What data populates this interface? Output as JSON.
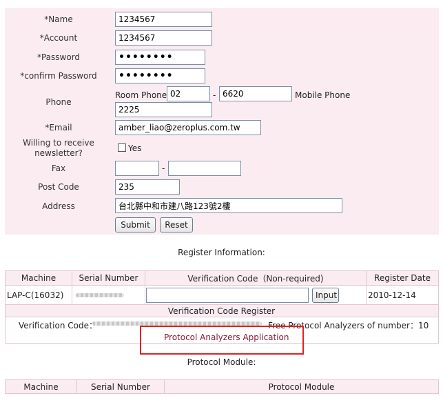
{
  "form": {
    "name_label": "*Name",
    "name_value": "1234567",
    "account_label": "*Account",
    "account_value": "1234567",
    "password_label": "*Password",
    "password_value": "••••••••",
    "confirm_label": "*confirm Password",
    "confirm_value": "••••••••",
    "phone_label": "Phone",
    "room_phone_label": "Room Phone",
    "room_phone_area": "02",
    "phone_dash": "-",
    "room_phone_number": "6620",
    "mobile_phone_label": "Mobile Phone",
    "ext_value": "2225",
    "email_label": "*Email",
    "email_value": "amber_liao@zeroplus.com.tw",
    "newsletter_label": "Willing to receive newsletter?",
    "newsletter_yes": "Yes",
    "fax_label": "Fax",
    "fax_dash": "-",
    "fax_area": "",
    "fax_number": "",
    "postcode_label": "Post Code",
    "postcode_value": "235",
    "address_label": "Address",
    "address_value": "台北縣中和市建八路123號2樓",
    "submit_label": "Submit",
    "reset_label": "Reset"
  },
  "register": {
    "title": "Register Information:",
    "headers": [
      "Machine",
      "Serial Number",
      "Verification Code（Non-required)",
      "Register Date"
    ],
    "row": {
      "machine": "LAP-C(16032)",
      "serial": "",
      "code_value": "",
      "input_button": "Input",
      "date": "2010-12-14"
    },
    "code_register_title": "Verification Code Register",
    "verification_label": "Verification Code：",
    "free_count_text": "Free Protocol Analyzers of number：10",
    "application_link": "Protocol Analyzers Application"
  },
  "module": {
    "title": "Protocol Module:",
    "headers": [
      "Machine",
      "Serial Number",
      "Protocol Module"
    ]
  },
  "colors": {
    "form_bg": "#faecf0",
    "link": "#8b1a2b",
    "highlight_box": "#e02020"
  }
}
